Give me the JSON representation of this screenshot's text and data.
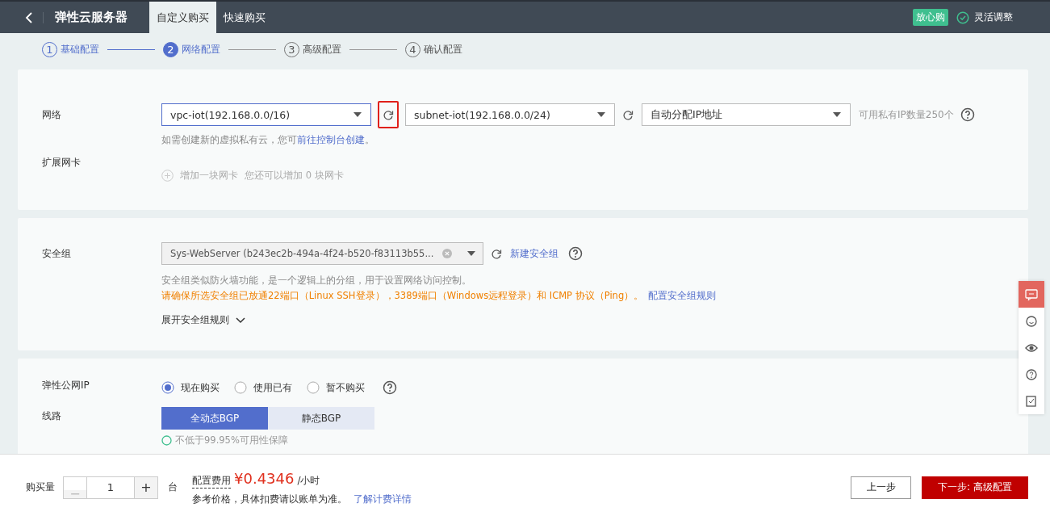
{
  "header": {
    "title": "弹性云服务器",
    "tabs": [
      {
        "label": "自定义购买",
        "selected": true
      },
      {
        "label": "快速购买",
        "selected": false
      }
    ],
    "badge": "放心购",
    "flex_label": "灵活调整"
  },
  "steps": [
    {
      "number": "1",
      "label": "基础配置",
      "completed": true,
      "selected": false
    },
    {
      "number": "2",
      "label": "网络配置",
      "completed": false,
      "selected": true
    },
    {
      "number": "3",
      "label": "高级配置",
      "completed": false,
      "selected": false
    },
    {
      "number": "4",
      "label": "确认配置",
      "completed": false,
      "selected": false
    }
  ],
  "network": {
    "label": "网络",
    "vpc": "vpc-iot(192.168.0.0/16)",
    "vpc_refresh_highlighted": true,
    "subnet": "subnet-iot(192.168.0.0/24)",
    "ip": "自动分配IP地址",
    "ip_count": "可用私有IP数量250个",
    "hint": "如需创建新的虚拟私有云，您可",
    "hint_link": "前往控制台创建",
    "hint_end": "。",
    "nic_label": "扩展网卡",
    "add_nic": "增加一块网卡",
    "nic_hint": "您还可以增加 0 块网卡"
  },
  "security": {
    "label": "安全组",
    "value": "Sys-WebServer  (b243ec2b-494a-4f24-b520-f83113b55...",
    "new_link": "新建安全组",
    "description": "安全组类似防火墙功能，是一个逻辑上的分组，用于设置网络访问控制。",
    "warning": "请确保所选安全组已放通22端口（Linux SSH登录），3389端口（Windows远程登录）和 ICMP 协议（Ping）。",
    "rules_link": "配置安全组规则",
    "expand": "展开安全组规则"
  },
  "eip": {
    "label": "弹性公网IP",
    "options": [
      {
        "label": "现在购买",
        "selected": true
      },
      {
        "label": "使用已有",
        "selected": false
      },
      {
        "label": "暂不购买",
        "selected": false
      }
    ],
    "line_label": "线路",
    "lines": [
      {
        "label": "全动态BGP",
        "selected": true
      },
      {
        "label": "静态BGP",
        "selected": false
      }
    ],
    "note": "不低于99.95%可用性保障"
  },
  "side_tools": [
    {
      "kind": "chat",
      "selected": true
    },
    {
      "kind": "smile",
      "selected": false
    },
    {
      "kind": "eye",
      "selected": false
    },
    {
      "kind": "help",
      "selected": false
    },
    {
      "kind": "note",
      "selected": false
    }
  ],
  "footer": {
    "qty_label": "购买量",
    "minus": "−",
    "qty": "1",
    "plus": "+",
    "unit": "台",
    "fee_label": "配置费用",
    "price": "¥0.4346",
    "per": "/小时",
    "note": "参考价格，具体扣费请以账单为准。",
    "note_link": "了解计费详情",
    "prev": "上一步",
    "next": "下一步: 高级配置"
  }
}
